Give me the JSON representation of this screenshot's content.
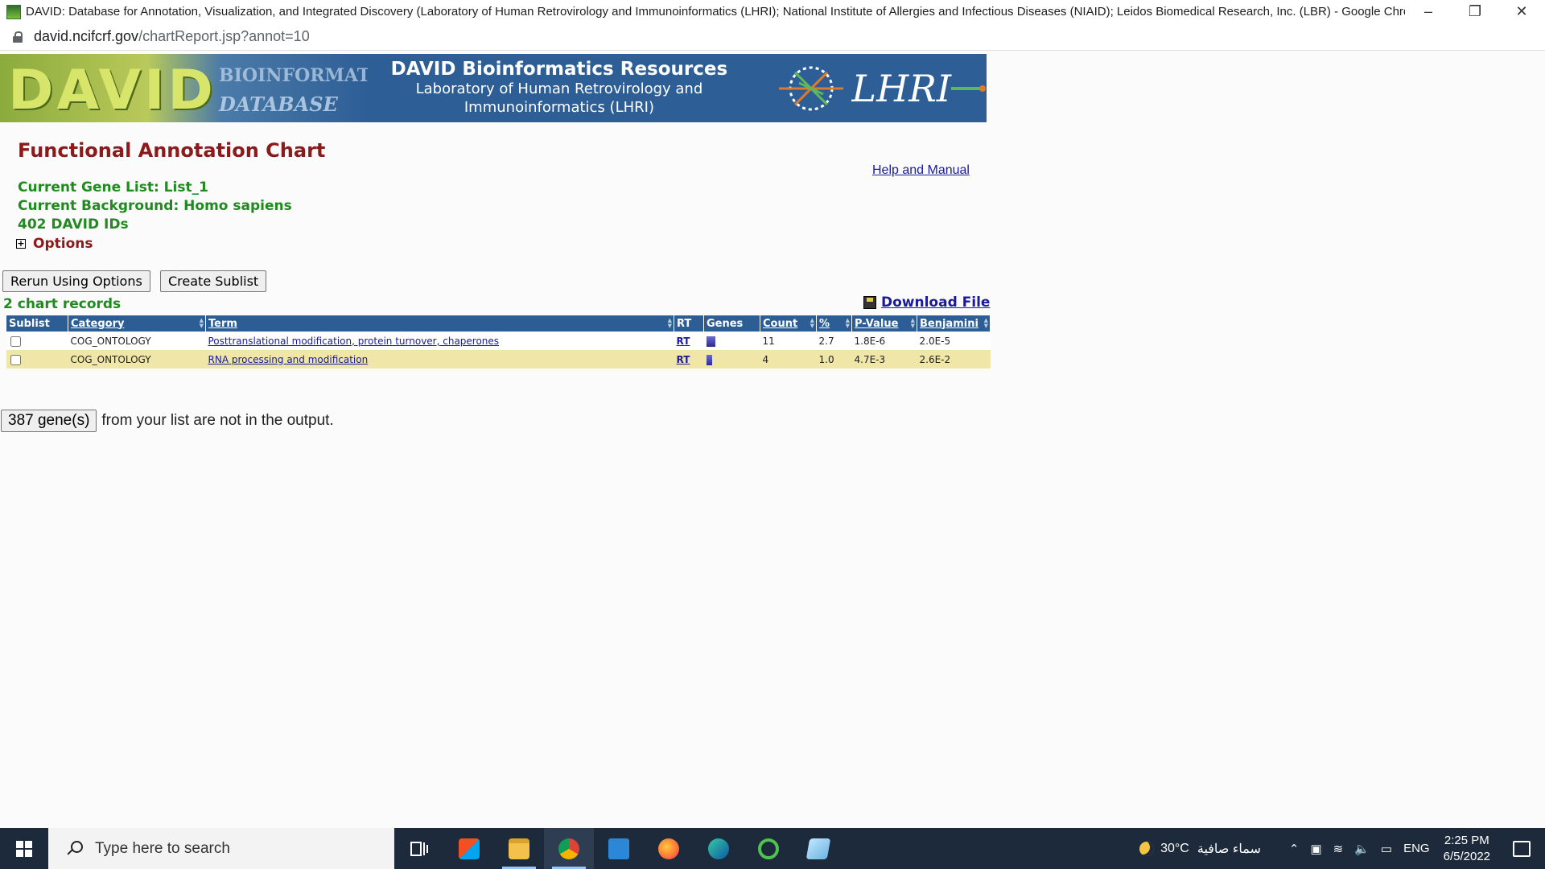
{
  "browser": {
    "window_title": "DAVID: Database for Annotation, Visualization, and Integrated Discovery (Laboratory of Human Retrovirology and Immunoinformatics (LHRI); National Institute of Allergies and Infectious Diseases (NIAID); Leidos Biomedical Research, Inc. (LBR) - Google Chrome",
    "url_host": "david.ncifcrf.gov",
    "url_path": "/chartReport.jsp?annot=10",
    "minimize_icon": "minimize-icon",
    "restore_icon": "restore-icon",
    "close_icon": "close-icon"
  },
  "banner": {
    "logo_text": "DAVID",
    "logo_sub1": "BIOINFORMATICS",
    "logo_sub2": "DATABASE",
    "title": "DAVID Bioinformatics Resources",
    "subtitle1": "Laboratory of Human Retrovirology and",
    "subtitle2": "Immunoinformatics (LHRI)",
    "lhri_logo": "LHRI"
  },
  "page": {
    "title": "Functional Annotation Chart",
    "help_link": "Help and Manual",
    "gene_list": "Current Gene List: List_1",
    "background": "Current Background: Homo sapiens",
    "david_ids": "402 DAVID IDs",
    "options_label": "Options",
    "rerun_button": "Rerun Using Options",
    "sublist_button": "Create Sublist",
    "records_count": "2 chart records",
    "download_label": "Download File"
  },
  "table": {
    "columns": [
      "Sublist",
      "Category",
      "Term",
      "RT",
      "Genes",
      "Count",
      "%",
      "P-Value",
      "Benjamini"
    ],
    "rows": [
      {
        "category": "COG_ONTOLOGY",
        "term": "Posttranslational modification, protein turnover, chaperones",
        "rt": "RT",
        "count": "11",
        "percent": "2.7",
        "pvalue": "1.8E-6",
        "benjamini": "2.0E-5"
      },
      {
        "category": "COG_ONTOLOGY",
        "term": "RNA processing and modification",
        "rt": "RT",
        "count": "4",
        "percent": "1.0",
        "pvalue": "4.7E-3",
        "benjamini": "2.6E-2"
      }
    ]
  },
  "footer_note": {
    "button": "387 gene(s)",
    "text": "from your list are not in the output."
  },
  "taskbar": {
    "search_placeholder": "Type here to search",
    "weather_temp": "30°C",
    "weather_text": "سماء صافية",
    "language": "ENG",
    "time": "2:25 PM",
    "date": "6/5/2022"
  },
  "colors": {
    "banner_bg": "#2d5e96",
    "title_red": "#8b1a1a",
    "info_green": "#1f8b1f",
    "header_blue": "#2c5d95",
    "row_highlight": "#efe6a8",
    "taskbar_bg": "#1c2a3c"
  }
}
